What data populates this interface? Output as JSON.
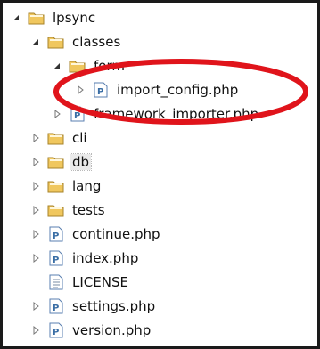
{
  "tree": [
    {
      "label": "lpsync",
      "type": "project",
      "expanded": true
    },
    {
      "label": "classes",
      "type": "package",
      "expanded": true
    },
    {
      "label": "form",
      "type": "package",
      "expanded": true
    },
    {
      "label": "import_config.php",
      "type": "php-file",
      "expanded": false
    },
    {
      "label": "framework_importer.php",
      "type": "php-file",
      "expanded": false
    },
    {
      "label": "cli",
      "type": "package",
      "expanded": false
    },
    {
      "label": "db",
      "type": "package",
      "expanded": false,
      "selected": true
    },
    {
      "label": "lang",
      "type": "package",
      "expanded": false
    },
    {
      "label": "tests",
      "type": "package",
      "expanded": false
    },
    {
      "label": "continue.php",
      "type": "php-file",
      "expanded": false
    },
    {
      "label": "index.php",
      "type": "php-file",
      "expanded": false
    },
    {
      "label": "LICENSE",
      "type": "text-file"
    },
    {
      "label": "settings.php",
      "type": "php-file",
      "expanded": false
    },
    {
      "label": "version.php",
      "type": "php-file",
      "expanded": false
    }
  ],
  "colors": {
    "annotation": "#e0141b",
    "folder": "#e8b84a",
    "php_icon": "#3a6ea5"
  }
}
